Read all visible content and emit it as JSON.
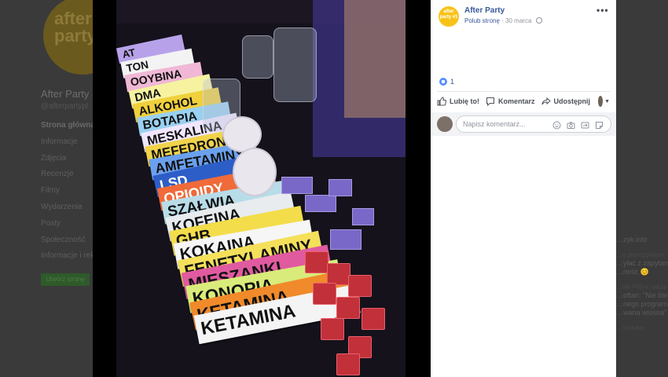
{
  "background_page": {
    "logo_text": "after party #1",
    "title": "After Party",
    "handle": "@afterpartypl",
    "nav": [
      "Strona główna",
      "Informacje",
      "Zdjęcia",
      "Recenzje",
      "Filmy",
      "Wydarzenia",
      "Posty",
      "Społeczność",
      "Informacje i reklamy"
    ],
    "cta": "Utwórz stronę",
    "side_title": "…zyk.info",
    "side_snippets": [
      "…ę przeczytałem",
      "…yłać z zapytaniem",
      "…ność 😊",
      "…nie PIS-e, także",
      "…oftań: \"Nie blerzcie",
      "…nego programu \"Tw",
      "…wana wiosna\"",
      "…ne lubię"
    ]
  },
  "photo": {
    "flyers": [
      "AT",
      "TON",
      "OOYBINA",
      "DMA",
      "ALKOHOL",
      "BOTAPIA",
      "MESKALINA",
      "MEFEDRON",
      "AMFETAMINY",
      "LSD",
      "OPIOIDY",
      "SZAŁWIA",
      "KOFEINA",
      "GHB",
      "KOKAINA",
      "FENETYLAMINY",
      "MIESZANKI",
      "KONOPIA",
      "KETAMINA",
      "KETAMINA"
    ],
    "flyer_colors": [
      "#b7a2ea",
      "#f3f3f3",
      "#f0b8d6",
      "#f6f2a0",
      "#f0d03c",
      "#9ad0f0",
      "#f0e6ff",
      "#f1d34a",
      "#6aa0ee",
      "#2d5ec7",
      "#f06a3a",
      "#b8dce8",
      "#e8ecef",
      "#f3dd4a",
      "#f6f6f6",
      "#f4e05a",
      "#e05aa0",
      "#d9eb7a",
      "#f08a2a",
      "#f4f4f4"
    ]
  },
  "post": {
    "page_name": "After Party",
    "avatar_text": "after party #1",
    "like_page": "Polub stronę",
    "separator": "·",
    "date": "30 marca",
    "reaction_count": "1",
    "actions": {
      "like": "Lubię to!",
      "comment": "Komentarz",
      "share": "Udostępnij"
    },
    "comment_placeholder": "Napisz komentarz..."
  },
  "colors": {
    "link": "#365899",
    "like_blue": "#5890ff",
    "avatar_yellow": "#f7c31a"
  }
}
